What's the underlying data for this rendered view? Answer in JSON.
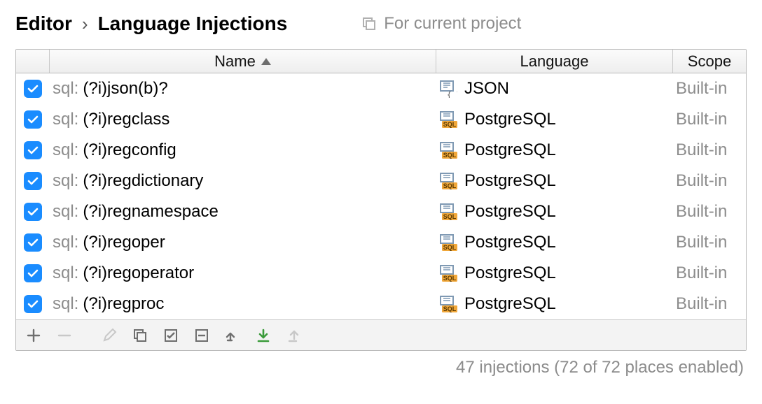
{
  "breadcrumb": {
    "root": "Editor",
    "sep": "›",
    "leaf": "Language Injections"
  },
  "project_hint": "For current project",
  "columns": {
    "checkbox": "",
    "name": "Name",
    "language": "Language",
    "scope": "Scope"
  },
  "sort": {
    "column": "name",
    "dir": "asc"
  },
  "rows": [
    {
      "checked": true,
      "prefix": "sql:",
      "pattern": "(?i)json(b)?",
      "lang_icon": "json",
      "language": "JSON",
      "scope": "Built-in"
    },
    {
      "checked": true,
      "prefix": "sql:",
      "pattern": "(?i)regclass",
      "lang_icon": "sql",
      "language": "PostgreSQL",
      "scope": "Built-in"
    },
    {
      "checked": true,
      "prefix": "sql:",
      "pattern": "(?i)regconfig",
      "lang_icon": "sql",
      "language": "PostgreSQL",
      "scope": "Built-in"
    },
    {
      "checked": true,
      "prefix": "sql:",
      "pattern": "(?i)regdictionary",
      "lang_icon": "sql",
      "language": "PostgreSQL",
      "scope": "Built-in"
    },
    {
      "checked": true,
      "prefix": "sql:",
      "pattern": "(?i)regnamespace",
      "lang_icon": "sql",
      "language": "PostgreSQL",
      "scope": "Built-in"
    },
    {
      "checked": true,
      "prefix": "sql:",
      "pattern": "(?i)regoper",
      "lang_icon": "sql",
      "language": "PostgreSQL",
      "scope": "Built-in"
    },
    {
      "checked": true,
      "prefix": "sql:",
      "pattern": "(?i)regoperator",
      "lang_icon": "sql",
      "language": "PostgreSQL",
      "scope": "Built-in"
    },
    {
      "checked": true,
      "prefix": "sql:",
      "pattern": "(?i)regproc",
      "lang_icon": "sql",
      "language": "PostgreSQL",
      "scope": "Built-in"
    }
  ],
  "status": "47 injections (72 of 72 places enabled)"
}
